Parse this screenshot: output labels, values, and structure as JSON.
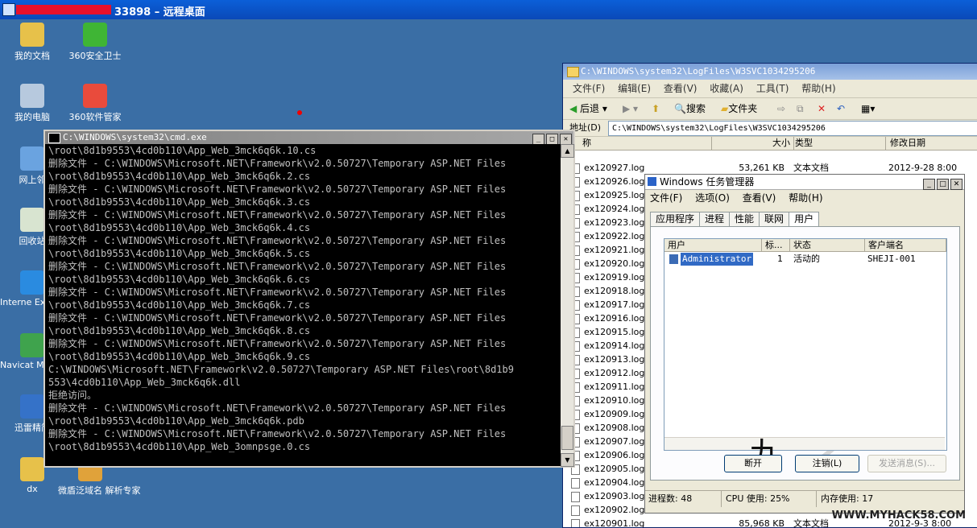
{
  "rdp": {
    "title_visible": "33898 – 远程桌面"
  },
  "desktop": {
    "icons": [
      {
        "label": "我的文档",
        "icon": "folder-docs-icon",
        "color": "#e7c14a"
      },
      {
        "label": "360安全卫士",
        "icon": "360-guard-icon",
        "color": "#3fb535"
      },
      {
        "label": "我的电脑",
        "icon": "computer-icon",
        "color": "#b7c9de"
      },
      {
        "label": "360软件管家",
        "icon": "360-softmgr-icon",
        "color": "#e94b3c"
      },
      {
        "label": "网上邻",
        "icon": "network-icon",
        "color": "#6aa3e0"
      },
      {
        "label": "回收站",
        "icon": "recycle-bin-icon",
        "color": "#d8e4d0"
      },
      {
        "label": "Interne Explore",
        "icon": "ie-icon",
        "color": "#2a8be0"
      },
      {
        "label": "Navicat MySQL",
        "icon": "navicat-icon",
        "color": "#3fa34d"
      },
      {
        "label": "迅雷精简",
        "icon": "thunder-icon",
        "color": "#3572c8"
      },
      {
        "label": "dx",
        "icon": "folder-icon",
        "color": "#e7c14a"
      },
      {
        "label": "微盾泛域名 解析专家",
        "icon": "shield-icon",
        "color": "#e0a23a"
      }
    ]
  },
  "explorer": {
    "title": "C:\\WINDOWS\\system32\\LogFiles\\W3SVC1034295206",
    "menu": [
      "文件(F)",
      "编辑(E)",
      "查看(V)",
      "收藏(A)",
      "工具(T)",
      "帮助(H)"
    ],
    "toolbar": {
      "back": "后退",
      "search": "搜索",
      "folders": "文件夹"
    },
    "address_label": "地址(D)",
    "address": "C:\\WINDOWS\\system32\\LogFiles\\W3SVC1034295206",
    "columns": [
      "称",
      "大小",
      "类型",
      "修改日期"
    ],
    "rows": [
      {
        "name": "ex120927.log",
        "size": "53,261 KB",
        "type": "文本文档",
        "date": "2012-9-28 8:00"
      },
      {
        "name": "ex120926.log",
        "size": "",
        "type": "",
        "date": ""
      },
      {
        "name": "ex120925.log",
        "size": "",
        "type": "",
        "date": ""
      },
      {
        "name": "ex120924.log",
        "size": "",
        "type": "",
        "date": ""
      },
      {
        "name": "ex120923.log",
        "size": "",
        "type": "",
        "date": ""
      },
      {
        "name": "ex120922.log",
        "size": "",
        "type": "",
        "date": ""
      },
      {
        "name": "ex120921.log",
        "size": "",
        "type": "",
        "date": ""
      },
      {
        "name": "ex120920.log",
        "size": "",
        "type": "",
        "date": ""
      },
      {
        "name": "ex120919.log",
        "size": "",
        "type": "",
        "date": ""
      },
      {
        "name": "ex120918.log",
        "size": "",
        "type": "",
        "date": ""
      },
      {
        "name": "ex120917.log",
        "size": "",
        "type": "",
        "date": ""
      },
      {
        "name": "ex120916.log",
        "size": "",
        "type": "",
        "date": ""
      },
      {
        "name": "ex120915.log",
        "size": "",
        "type": "",
        "date": ""
      },
      {
        "name": "ex120914.log",
        "size": "",
        "type": "",
        "date": ""
      },
      {
        "name": "ex120913.log",
        "size": "",
        "type": "",
        "date": ""
      },
      {
        "name": "ex120912.log",
        "size": "",
        "type": "",
        "date": ""
      },
      {
        "name": "ex120911.log",
        "size": "",
        "type": "",
        "date": ""
      },
      {
        "name": "ex120910.log",
        "size": "",
        "type": "",
        "date": ""
      },
      {
        "name": "ex120909.log",
        "size": "",
        "type": "",
        "date": ""
      },
      {
        "name": "ex120908.log",
        "size": "",
        "type": "",
        "date": ""
      },
      {
        "name": "ex120907.log",
        "size": "",
        "type": "",
        "date": ""
      },
      {
        "name": "ex120906.log",
        "size": "",
        "type": "",
        "date": ""
      },
      {
        "name": "ex120905.log",
        "size": "",
        "type": "",
        "date": ""
      },
      {
        "name": "ex120904.log",
        "size": "",
        "type": "",
        "date": ""
      },
      {
        "name": "ex120903.log",
        "size": "",
        "type": "",
        "date": ""
      },
      {
        "name": "ex120902.log",
        "size": "",
        "type": "",
        "date": ""
      },
      {
        "name": "ex120901.log",
        "size": "85,968 KB",
        "type": "文本文档",
        "date": "2012-9-3 8:00"
      }
    ]
  },
  "cmd": {
    "title": "C:\\WINDOWS\\system32\\cmd.exe",
    "lines": [
      "\\root\\8d1b9553\\4cd0b110\\App_Web_3mck6q6k.10.cs",
      "删除文件 - C:\\WINDOWS\\Microsoft.NET\\Framework\\v2.0.50727\\Temporary ASP.NET Files",
      "\\root\\8d1b9553\\4cd0b110\\App_Web_3mck6q6k.2.cs",
      "删除文件 - C:\\WINDOWS\\Microsoft.NET\\Framework\\v2.0.50727\\Temporary ASP.NET Files",
      "\\root\\8d1b9553\\4cd0b110\\App_Web_3mck6q6k.3.cs",
      "删除文件 - C:\\WINDOWS\\Microsoft.NET\\Framework\\v2.0.50727\\Temporary ASP.NET Files",
      "\\root\\8d1b9553\\4cd0b110\\App_Web_3mck6q6k.4.cs",
      "删除文件 - C:\\WINDOWS\\Microsoft.NET\\Framework\\v2.0.50727\\Temporary ASP.NET Files",
      "\\root\\8d1b9553\\4cd0b110\\App_Web_3mck6q6k.5.cs",
      "删除文件 - C:\\WINDOWS\\Microsoft.NET\\Framework\\v2.0.50727\\Temporary ASP.NET Files",
      "\\root\\8d1b9553\\4cd0b110\\App_Web_3mck6q6k.6.cs",
      "删除文件 - C:\\WINDOWS\\Microsoft.NET\\Framework\\v2.0.50727\\Temporary ASP.NET Files",
      "\\root\\8d1b9553\\4cd0b110\\App_Web_3mck6q6k.7.cs",
      "删除文件 - C:\\WINDOWS\\Microsoft.NET\\Framework\\v2.0.50727\\Temporary ASP.NET Files",
      "\\root\\8d1b9553\\4cd0b110\\App_Web_3mck6q6k.8.cs",
      "删除文件 - C:\\WINDOWS\\Microsoft.NET\\Framework\\v2.0.50727\\Temporary ASP.NET Files",
      "\\root\\8d1b9553\\4cd0b110\\App_Web_3mck6q6k.9.cs",
      "C:\\WINDOWS\\Microsoft.NET\\Framework\\v2.0.50727\\Temporary ASP.NET Files\\root\\8d1b9",
      "553\\4cd0b110\\App_Web_3mck6q6k.dll",
      "拒绝访问。",
      "删除文件 - C:\\WINDOWS\\Microsoft.NET\\Framework\\v2.0.50727\\Temporary ASP.NET Files",
      "\\root\\8d1b9553\\4cd0b110\\App_Web_3mck6q6k.pdb",
      "删除文件 - C:\\WINDOWS\\Microsoft.NET\\Framework\\v2.0.50727\\Temporary ASP.NET Files",
      "\\root\\8d1b9553\\4cd0b110\\App_Web_3omnpsge.0.cs"
    ]
  },
  "taskmgr": {
    "title": "Windows 任务管理器",
    "menu": [
      "文件(F)",
      "选项(O)",
      "查看(V)",
      "帮助(H)"
    ],
    "tabs": [
      "应用程序",
      "进程",
      "性能",
      "联网",
      "用户"
    ],
    "columns": [
      "用户",
      "标...",
      "状态",
      "客户端名"
    ],
    "user_row": {
      "user": "Administrator",
      "id": "1",
      "status": "活动的",
      "client": "SHEJI-001"
    },
    "buttons": {
      "disconnect": "断开",
      "logoff": "注销(L)",
      "send_message": "发送消息(S)..."
    },
    "status": {
      "processes": "进程数: 48",
      "cpu": "CPU 使用: 25%",
      "memory": "内存使用: 17"
    }
  },
  "watermark": "WWW.MYHACK58.COM"
}
